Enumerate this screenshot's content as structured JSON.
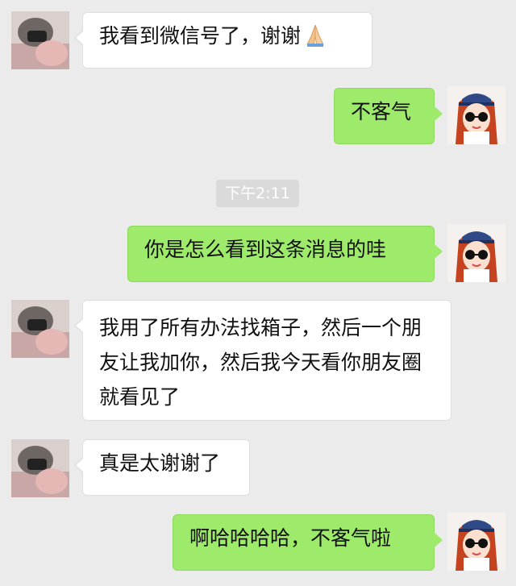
{
  "messages": [
    {
      "side": "left",
      "text": "我看到微信号了，谢谢"
    },
    {
      "side": "right",
      "text": "不客气"
    },
    {
      "side": "right",
      "text": "你是怎么看到这条消息的哇"
    },
    {
      "side": "left",
      "text": "我用了所有办法找箱子，然后一个朋友让我加你，然后我今天看你朋友圈就看见了"
    },
    {
      "side": "left",
      "text": "真是太谢谢了"
    },
    {
      "side": "right",
      "text": "啊哈哈哈哈，不客气啦"
    }
  ],
  "timestamp": "下午2:11",
  "icons": {
    "prayer": "folded-hands-emoji",
    "contact_avatar": "contact-avatar",
    "self_avatar": "self-avatar-cartoon-girl"
  },
  "colors": {
    "background": "#ebebeb",
    "sent_bubble": "#9eea6a",
    "received_bubble": "#ffffff",
    "timestamp_bg": "#dadada"
  }
}
